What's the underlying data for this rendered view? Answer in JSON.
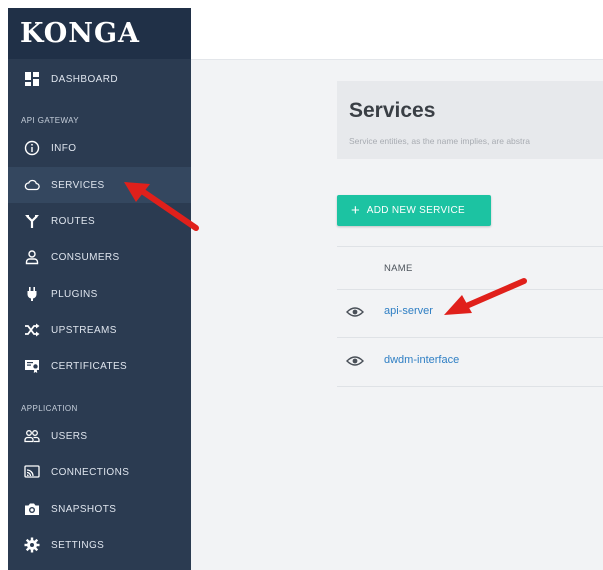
{
  "app": {
    "logo": "KONGA"
  },
  "sidebar": {
    "dashboard": "DASHBOARD",
    "section_api_gateway": "API GATEWAY",
    "api_items": [
      "INFO",
      "SERVICES",
      "ROUTES",
      "CONSUMERS",
      "PLUGINS",
      "UPSTREAMS",
      "CERTIFICATES"
    ],
    "section_application": "APPLICATION",
    "app_items": [
      "USERS",
      "CONNECTIONS",
      "SNAPSHOTS",
      "SETTINGS"
    ],
    "active_item": "SERVICES"
  },
  "page": {
    "title": "Services",
    "description": "Service entities, as the name implies, are abstra",
    "add_button": "ADD NEW SERVICE",
    "table_header": "NAME",
    "rows": [
      "api-server",
      "dwdm-interface"
    ]
  },
  "colors": {
    "sidebar_bg": "#2b3b51",
    "accent_button": "#1cc3a2",
    "link": "#2f7fc4",
    "annotation_arrow": "#e0201b"
  }
}
